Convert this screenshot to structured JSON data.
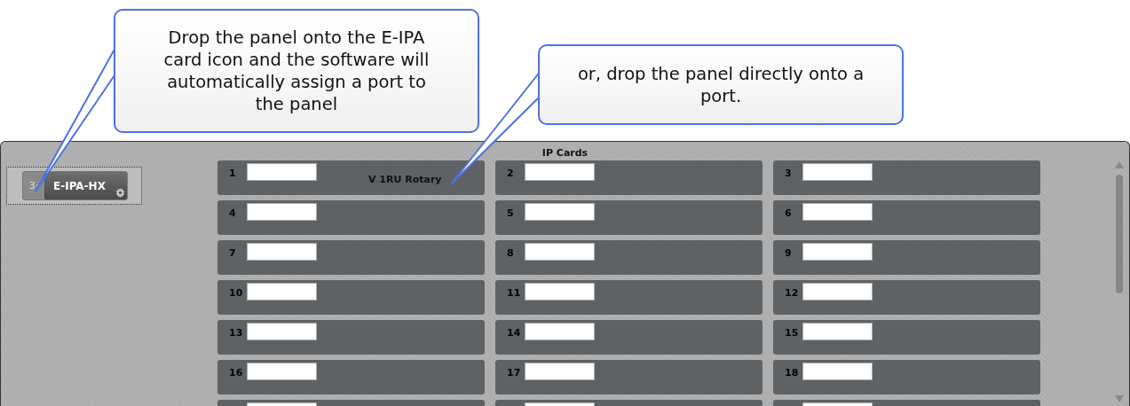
{
  "callouts": [
    {
      "text": "Drop the panel onto the E-IPA card icon and the software will automatically assign a port to the panel"
    },
    {
      "text": "or, drop the panel directly onto a port."
    }
  ],
  "panel": {
    "title": "IP Cards",
    "device": {
      "slot": "3:",
      "name": "E-IPA-HX"
    },
    "ports": [
      {
        "kind": "port",
        "number": "1",
        "assigned": "V 1RU Rotary"
      },
      {
        "kind": "port",
        "number": "2"
      },
      {
        "kind": "port",
        "number": "3"
      },
      {
        "kind": "port",
        "number": "4"
      },
      {
        "kind": "port",
        "number": "5"
      },
      {
        "kind": "port",
        "number": "6"
      },
      {
        "kind": "port",
        "number": "7"
      },
      {
        "kind": "port",
        "number": "8"
      },
      {
        "kind": "port",
        "number": "9"
      },
      {
        "kind": "port",
        "number": "10"
      },
      {
        "kind": "port",
        "number": "11"
      },
      {
        "kind": "port",
        "number": "12"
      },
      {
        "kind": "port",
        "number": "13"
      },
      {
        "kind": "port",
        "number": "14"
      },
      {
        "kind": "port",
        "number": "15"
      },
      {
        "kind": "port",
        "number": "16"
      },
      {
        "kind": "port",
        "number": "17"
      },
      {
        "kind": "port",
        "number": "18"
      },
      {
        "kind": "partial"
      },
      {
        "kind": "partial"
      },
      {
        "kind": "partial"
      }
    ]
  }
}
